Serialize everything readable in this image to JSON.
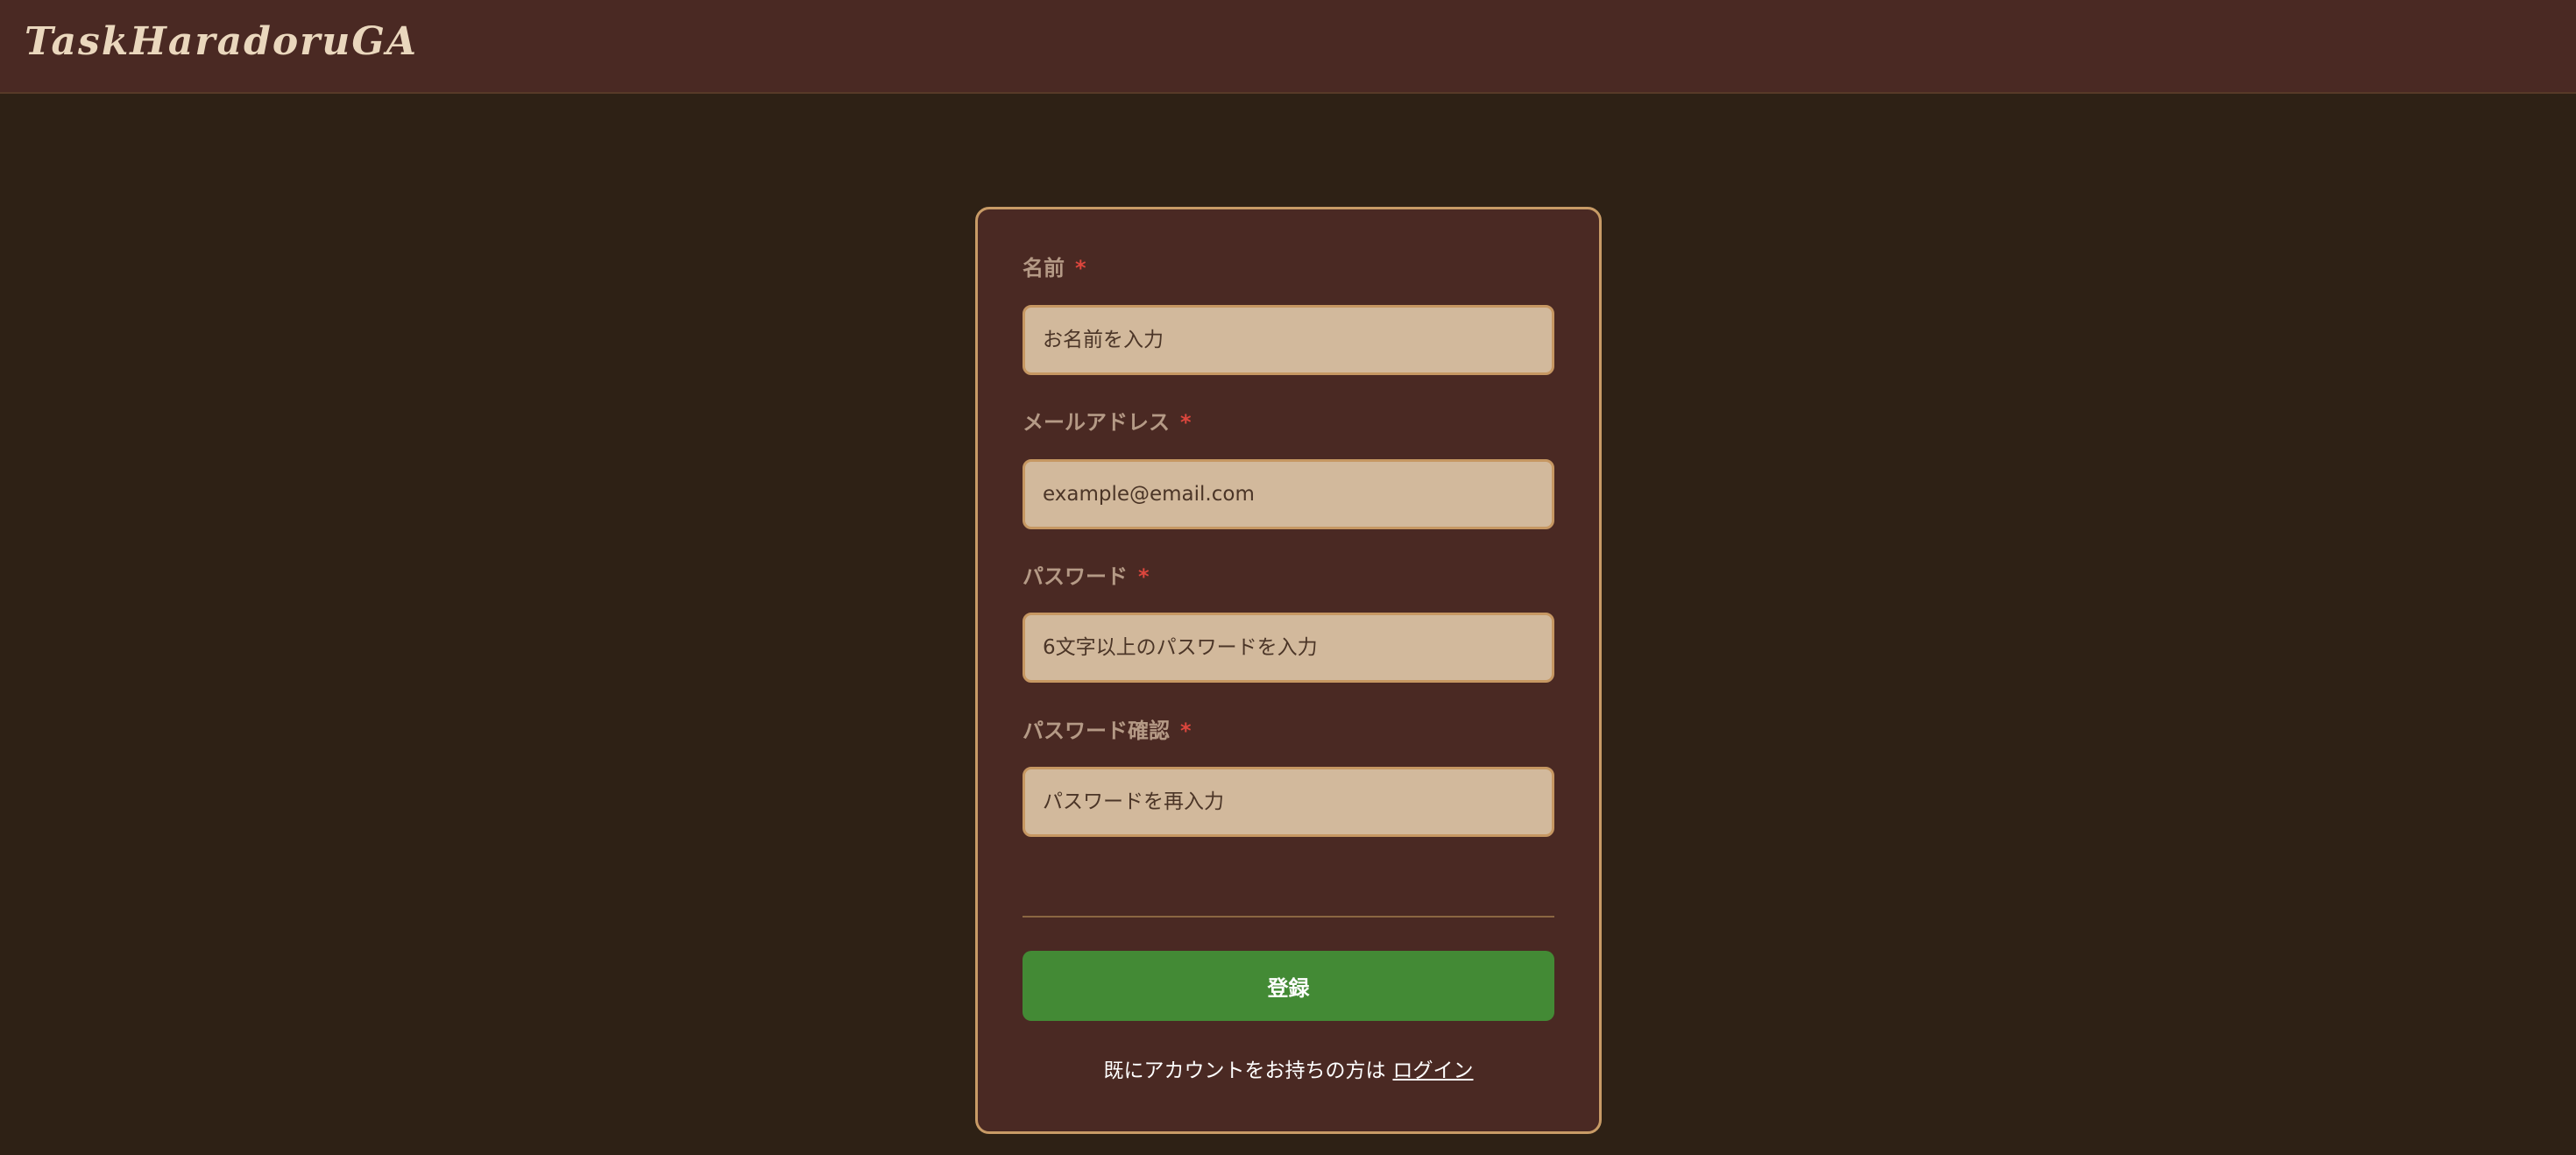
{
  "header": {
    "logo": "TaskHaradoruGA"
  },
  "form": {
    "fields": [
      {
        "label": "名前",
        "required_mark": "*",
        "placeholder": "お名前を入力"
      },
      {
        "label": "メールアドレス",
        "required_mark": "*",
        "placeholder": "example@email.com"
      },
      {
        "label": "パスワード",
        "required_mark": "*",
        "placeholder": "6文字以上のパスワードを入力"
      },
      {
        "label": "パスワード確認",
        "required_mark": "*",
        "placeholder": "パスワードを再入力"
      }
    ],
    "submit_label": "登録",
    "login_prompt": "既にアカウントをお持ちの方は",
    "login_link": "ログイン"
  },
  "colors": {
    "page_background": "#2e2115",
    "header_background": "#4a2923",
    "card_background": "#4a2923",
    "card_border": "#c89b66",
    "input_background": "#d2b99c",
    "input_border": "#c69762",
    "required_mark": "#dc463d",
    "submit_button": "#438a35",
    "logo_text": "#ead7bd"
  }
}
